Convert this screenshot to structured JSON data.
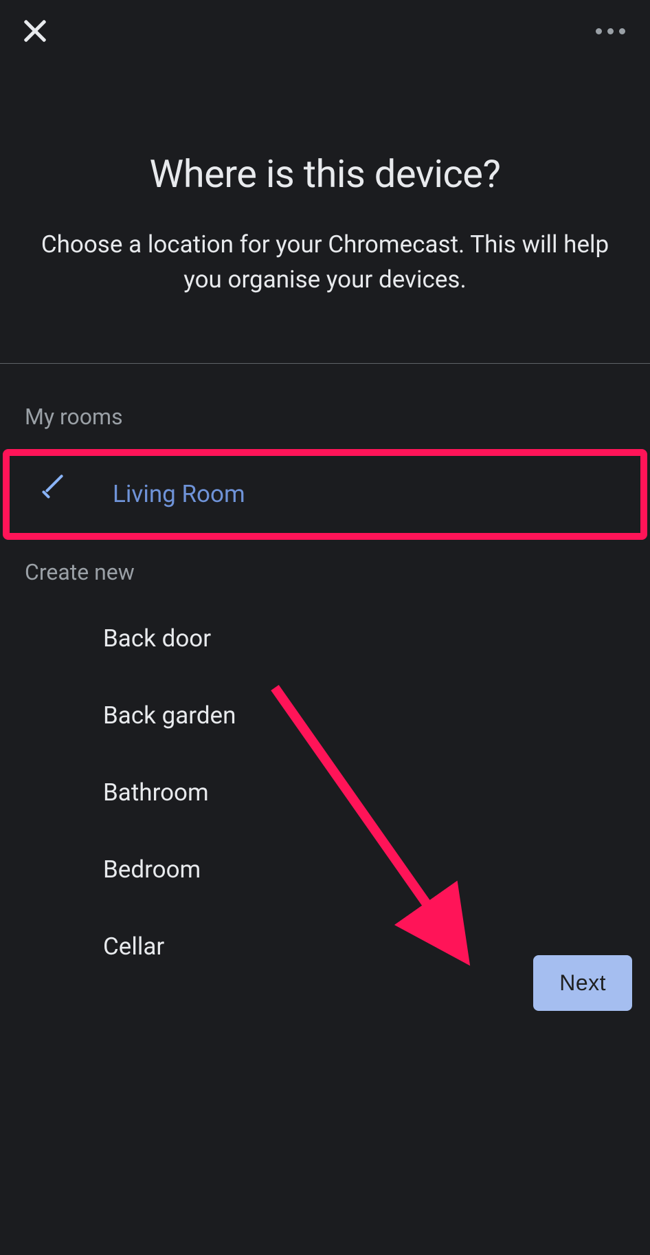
{
  "header": {
    "title": "Where is this device?",
    "subtitle": "Choose a location for your Chromecast. This will help you organise your devices."
  },
  "sections": {
    "my_rooms_label": "My rooms",
    "create_new_label": "Create new"
  },
  "selected_room": "Living Room",
  "rooms": {
    "living_room": "Living Room",
    "back_door": "Back door",
    "back_garden": "Back garden",
    "bathroom": "Bathroom",
    "bedroom": "Bedroom",
    "cellar": "Cellar"
  },
  "buttons": {
    "next": "Next"
  },
  "annotation": {
    "highlight_target": "room-living-room",
    "arrow_target": "next-button",
    "color": "#ff1458"
  }
}
